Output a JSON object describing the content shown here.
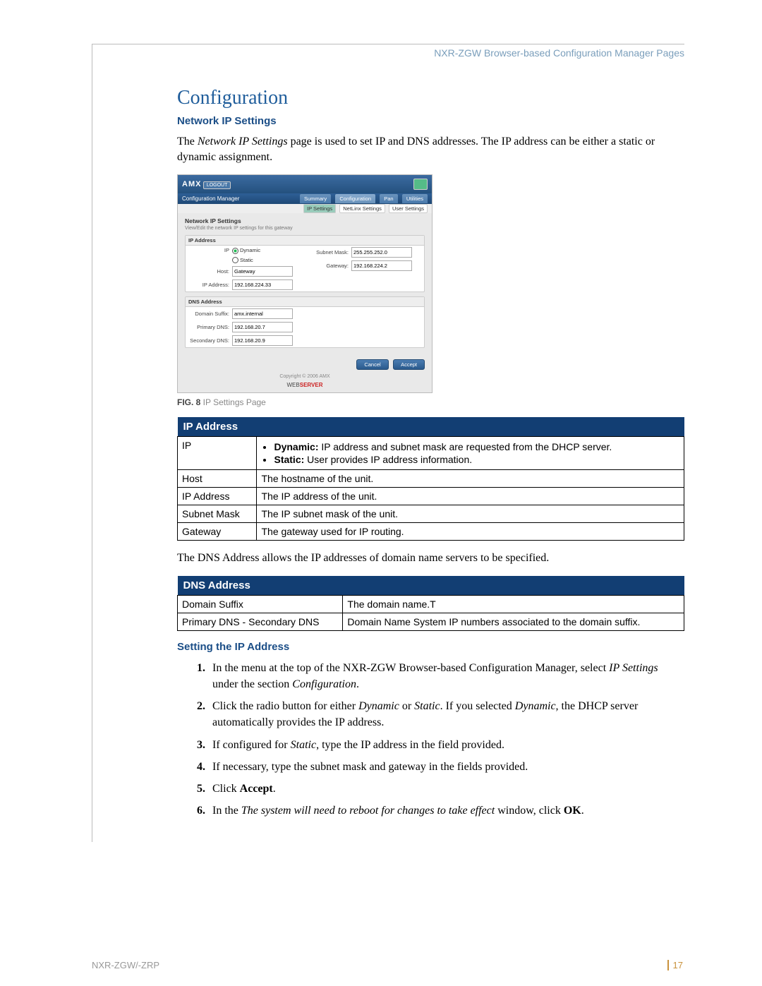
{
  "header": "NXR-ZGW Browser-based Configuration Manager Pages",
  "h1": "Configuration",
  "section1": {
    "title": "Network IP Settings",
    "para": {
      "pre": "The ",
      "em": "Network IP Settings",
      "post": " page is used to set IP and DNS addresses. The IP address can be either a static or dynamic assignment."
    }
  },
  "screenshot": {
    "logo": "AMX",
    "logout": "LOGOUT",
    "manager": "Configuration Manager",
    "tabs": {
      "summary": "Summary",
      "configuration": "Configuration",
      "pan": "Pan",
      "utilities": "Utilities"
    },
    "subtabs": {
      "ips": "IP Settings",
      "netsec": "NetLinx Settings",
      "usersec": "User Settings"
    },
    "panel_title": "Network IP Settings",
    "panel_hint": "View/Edit the network IP settings for this gateway",
    "ip_legend": "IP Address",
    "ip_label": "IP",
    "dynamic": "Dynamic",
    "static": "Static",
    "host_label": "Host:",
    "host_val": "Gateway",
    "ipaddr_label": "IP Address:",
    "ipaddr_val": "192.168.224.33",
    "subnet_label": "Subnet Mask:",
    "subnet_val": "255.255.252.0",
    "gateway_label": "Gateway:",
    "gateway_val": "192.168.224.2",
    "dns_legend": "DNS Address",
    "domain_label": "Domain Suffix:",
    "domain_val": "amx.internal",
    "pdns_label": "Primary DNS:",
    "pdns_val": "192.168.20.7",
    "sdns_label": "Secondary DNS:",
    "sdns_val": "192.168.20.9",
    "cancel": "Cancel",
    "accept": "Accept",
    "copy": "Copyright © 2006 AMX",
    "web1": "WEB",
    "web2": "SERVER"
  },
  "fig": {
    "label": "FIG. 8",
    "text": "  IP Settings Page"
  },
  "table1": {
    "title": "IP Address",
    "rows": {
      "ip": {
        "label": "IP",
        "l1pre": "Dynamic:",
        "l1": " IP address and subnet mask are requested from the DHCP server.",
        "l2pre": "Static:",
        "l2": " User provides IP address information."
      },
      "host": {
        "label": "Host",
        "val": "The hostname of the unit."
      },
      "ipaddr": {
        "label": "IP Address",
        "val": "The IP address of the unit."
      },
      "subnet": {
        "label": "Subnet Mask",
        "val": "The IP subnet mask of the unit."
      },
      "gateway": {
        "label": "Gateway",
        "val": "The gateway used for IP routing."
      }
    }
  },
  "para2": "The DNS Address allows the IP addresses of domain name servers to be specified.",
  "table2": {
    "title": "DNS Address",
    "rows": {
      "domain": {
        "label": "Domain Suffix",
        "val": "The domain name.T"
      },
      "dns": {
        "label": "Primary DNS - Secondary DNS",
        "val": "Domain Name System IP numbers associated to the domain suffix."
      }
    }
  },
  "section2": {
    "title": "Setting the IP Address",
    "steps": {
      "s1": {
        "a": "In the menu at the top of the NXR-ZGW Browser-based Configuration Manager, select ",
        "b": "IP Settings",
        "c": " under the section ",
        "d": "Configuration",
        "e": "."
      },
      "s2": {
        "a": "Click the radio button for either ",
        "b": "Dynamic",
        "c": " or ",
        "d": "Static",
        "e": ". If you selected ",
        "f": "Dynamic,",
        "g": " the DHCP server automatically provides the IP address."
      },
      "s3": {
        "a": "If configured for ",
        "b": "Static",
        "c": ", type the IP address in the field provided."
      },
      "s4": "If necessary, type the subnet mask and gateway in the fields provided.",
      "s5": {
        "a": "Click ",
        "b": "Accept",
        "c": "."
      },
      "s6": {
        "a": "In the ",
        "b": "The system will need to reboot for changes to take effect",
        "c": " window, click ",
        "d": "OK",
        "e": "."
      }
    }
  },
  "footer": {
    "doc": "NXR-ZGW/-ZRP",
    "page": "17"
  }
}
